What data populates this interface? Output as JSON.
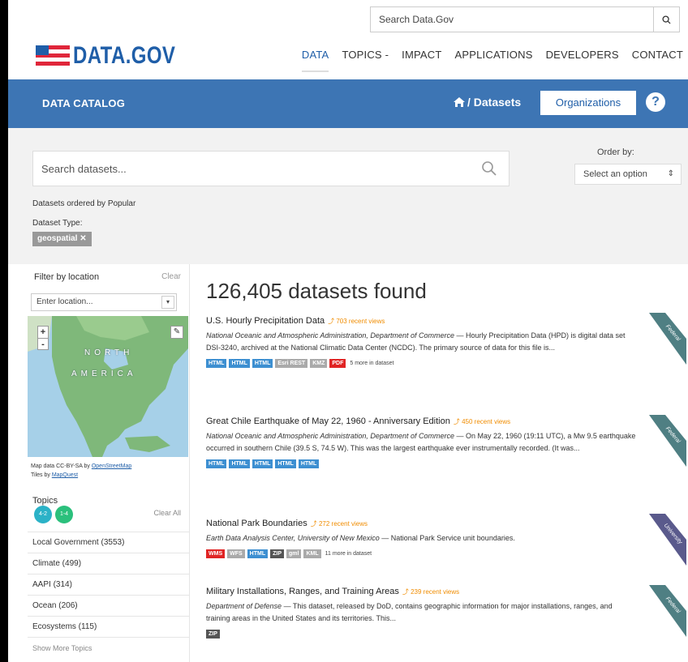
{
  "top_search": {
    "placeholder": "Search Data.Gov"
  },
  "brand": {
    "name": "DATA.GOV"
  },
  "nav": [
    "DATA",
    "TOPICS -",
    "IMPACT",
    "APPLICATIONS",
    "DEVELOPERS",
    "CONTACT"
  ],
  "bar": {
    "catalog": "DATA CATALOG",
    "breadcrumb": "/ Datasets",
    "organizations": "Organizations",
    "help": "?"
  },
  "search": {
    "placeholder": "Search datasets...",
    "order_label": "Order by:",
    "order_value": "Select an option",
    "ordered_by": "Datasets ordered by Popular",
    "dataset_type_label": "Dataset Type:",
    "dataset_type_tag": "geospatial ✕"
  },
  "sidebar": {
    "filter_location": "Filter by location",
    "clear": "Clear",
    "location_placeholder": "Enter location...",
    "map_label_north": "NORTH",
    "map_label_america": "AMERICA",
    "map_attr_1": "Map data CC-BY-SA by",
    "map_attr_1_link": "OpenStreetMap",
    "map_attr_2": "Tiles by",
    "map_attr_2_link": "MapQuest",
    "topics": "Topics",
    "clear_all": "Clear All",
    "badges": [
      "4-2",
      "1-4"
    ],
    "topic_list": [
      "Local Government (3553)",
      "Climate (499)",
      "AAPI (314)",
      "Ocean (206)",
      "Ecosystems (115)"
    ],
    "show_more": "Show More Topics"
  },
  "results": {
    "count": "126,405 datasets found",
    "items": [
      {
        "title": "U.S. Hourly Precipitation Data",
        "views": "703 recent views",
        "org": "National Oceanic and Atmospheric Administration, Department of Commerce",
        "desc": " — Hourly Precipitation Data (HPD) is digital data set DSI-3240, archived at the National Climatic Data Center (NCDC). The primary source of data for this file is...",
        "formats": [
          "HTML",
          "HTML",
          "HTML",
          "Esri REST",
          "KMZ",
          "PDF"
        ],
        "more": "5 more in dataset",
        "ribbon": "Federal",
        "ribbon_color": "#4f7f83"
      },
      {
        "title": "Great Chile Earthquake of May 22, 1960 - Anniversary Edition",
        "views": "450 recent views",
        "org": "National Oceanic and Atmospheric Administration, Department of Commerce",
        "desc": " — On May 22, 1960 (19:11 UTC), a Mw 9.5 earthquake occurred in southern Chile (39.5 S, 74.5 W). This was the largest earthquake ever instrumentally recorded. (It was...",
        "formats": [
          "HTML",
          "HTML",
          "HTML",
          "HTML",
          "HTML"
        ],
        "more": "",
        "ribbon": "Federal",
        "ribbon_color": "#4f7f83"
      },
      {
        "title": "National Park Boundaries",
        "views": "272 recent views",
        "org": "Earth Data Analysis Center, University of New Mexico",
        "desc": " — National Park Service unit boundaries.",
        "formats": [
          "WMS",
          "WFS",
          "HTML",
          "ZIP",
          "gml",
          "KML"
        ],
        "more": "11 more in dataset",
        "ribbon": "University",
        "ribbon_color": "#5a5a8c"
      },
      {
        "title": "Military Installations, Ranges, and Training Areas",
        "views": "239 recent views",
        "org": "Department of Defense",
        "desc": " — This dataset, released by DoD, contains geographic information for major installations, ranges, and training areas in the United States and its territories. This...",
        "formats": [
          "ZIP"
        ],
        "more": "",
        "ribbon": "Federal",
        "ribbon_color": "#4f7f83"
      }
    ]
  },
  "colors": {
    "brand_blue": "#1f5ea8",
    "bar_blue": "#3d75b4",
    "views_orange": "#f08c00",
    "format_blue": "#3d8fd1"
  }
}
